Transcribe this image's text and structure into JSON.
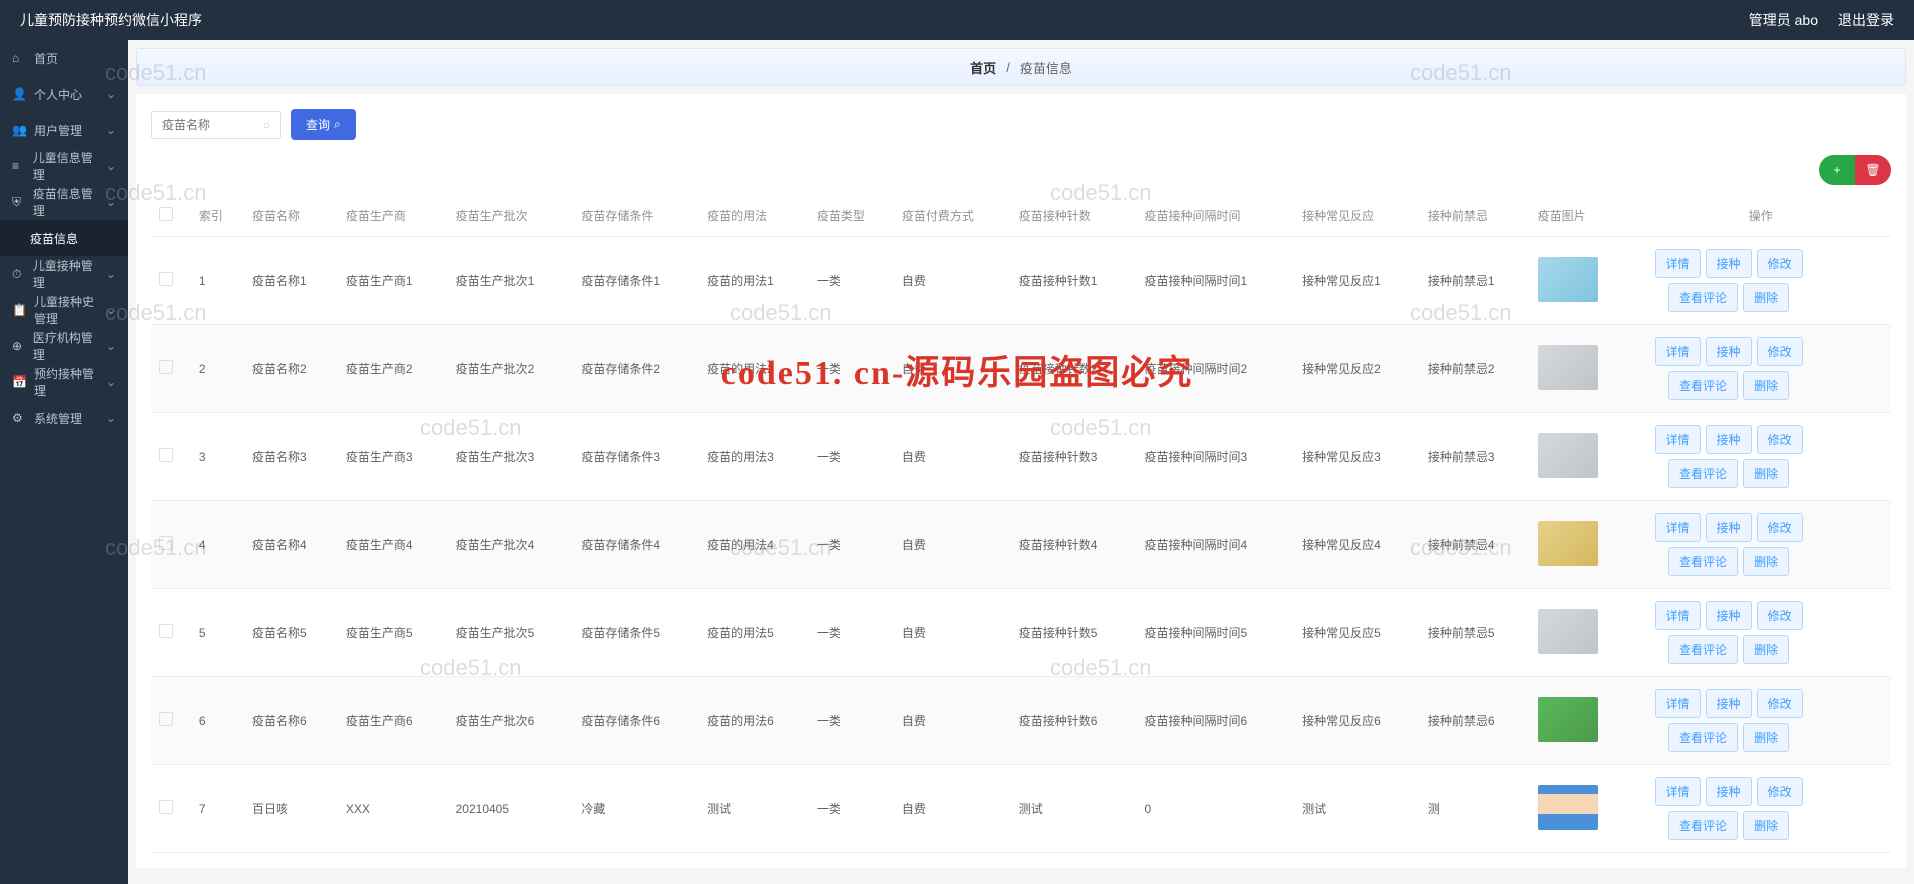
{
  "header": {
    "title": "儿童预防接种预约微信小程序",
    "admin": "管理员 abo",
    "logout": "退出登录"
  },
  "sidebar": {
    "items": [
      {
        "icon": "home",
        "label": "首页"
      },
      {
        "icon": "user",
        "label": "个人中心",
        "expand": true
      },
      {
        "icon": "users",
        "label": "用户管理",
        "expand": true
      },
      {
        "icon": "list",
        "label": "儿童信息管理",
        "expand": true
      },
      {
        "icon": "shield",
        "label": "疫苗信息管理",
        "expand": true
      },
      {
        "icon": "",
        "label": "疫苗信息",
        "sub": true
      },
      {
        "icon": "clock",
        "label": "儿童接种管理",
        "expand": true
      },
      {
        "icon": "doc",
        "label": "儿童接种史管理",
        "expand": true
      },
      {
        "icon": "hospital",
        "label": "医疗机构管理",
        "expand": true
      },
      {
        "icon": "calendar",
        "label": "预约接种管理",
        "expand": true
      },
      {
        "icon": "gear",
        "label": "系统管理",
        "expand": true
      }
    ]
  },
  "breadcrumb": {
    "home": "首页",
    "sep": "/",
    "current": "疫苗信息"
  },
  "search": {
    "placeholder": "疫苗名称",
    "button": "查询"
  },
  "table": {
    "headers": [
      "",
      "索引",
      "疫苗名称",
      "疫苗生产商",
      "疫苗生产批次",
      "疫苗存储条件",
      "疫苗的用法",
      "疫苗类型",
      "疫苗付费方式",
      "疫苗接种针数",
      "疫苗接种间隔时间",
      "接种常见反应",
      "接种前禁忌",
      "疫苗图片",
      "操作"
    ],
    "rows": [
      {
        "idx": "1",
        "name": "疫苗名称1",
        "mfr": "疫苗生产商1",
        "batch": "疫苗生产批次1",
        "storage": "疫苗存储条件1",
        "usage": "疫苗的用法1",
        "type": "一类",
        "pay": "自费",
        "doses": "疫苗接种针数1",
        "interval": "疫苗接种间隔时间1",
        "reaction": "接种常见反应1",
        "taboo": "接种前禁忌1",
        "img": "blue"
      },
      {
        "idx": "2",
        "name": "疫苗名称2",
        "mfr": "疫苗生产商2",
        "batch": "疫苗生产批次2",
        "storage": "疫苗存储条件2",
        "usage": "疫苗的用法2",
        "type": "一类",
        "pay": "自费",
        "doses": "疫苗接种针数2",
        "interval": "疫苗接种间隔时间2",
        "reaction": "接种常见反应2",
        "taboo": "接种前禁忌2",
        "img": "gray"
      },
      {
        "idx": "3",
        "name": "疫苗名称3",
        "mfr": "疫苗生产商3",
        "batch": "疫苗生产批次3",
        "storage": "疫苗存储条件3",
        "usage": "疫苗的用法3",
        "type": "一类",
        "pay": "自费",
        "doses": "疫苗接种针数3",
        "interval": "疫苗接种间隔时间3",
        "reaction": "接种常见反应3",
        "taboo": "接种前禁忌3",
        "img": "gray"
      },
      {
        "idx": "4",
        "name": "疫苗名称4",
        "mfr": "疫苗生产商4",
        "batch": "疫苗生产批次4",
        "storage": "疫苗存储条件4",
        "usage": "疫苗的用法4",
        "type": "一类",
        "pay": "自费",
        "doses": "疫苗接种针数4",
        "interval": "疫苗接种间隔时间4",
        "reaction": "接种常见反应4",
        "taboo": "接种前禁忌4",
        "img": "yellow"
      },
      {
        "idx": "5",
        "name": "疫苗名称5",
        "mfr": "疫苗生产商5",
        "batch": "疫苗生产批次5",
        "storage": "疫苗存储条件5",
        "usage": "疫苗的用法5",
        "type": "一类",
        "pay": "自费",
        "doses": "疫苗接种针数5",
        "interval": "疫苗接种间隔时间5",
        "reaction": "接种常见反应5",
        "taboo": "接种前禁忌5",
        "img": "gray"
      },
      {
        "idx": "6",
        "name": "疫苗名称6",
        "mfr": "疫苗生产商6",
        "batch": "疫苗生产批次6",
        "storage": "疫苗存储条件6",
        "usage": "疫苗的用法6",
        "type": "一类",
        "pay": "自费",
        "doses": "疫苗接种针数6",
        "interval": "疫苗接种间隔时间6",
        "reaction": "接种常见反应6",
        "taboo": "接种前禁忌6",
        "img": "green"
      },
      {
        "idx": "7",
        "name": "百日咳",
        "mfr": "XXX",
        "batch": "20210405",
        "storage": "冷藏",
        "usage": "测试",
        "type": "一类",
        "pay": "自费",
        "doses": "测试",
        "interval": "0",
        "reaction": "测试",
        "taboo": "测",
        "img": "face"
      }
    ],
    "actions": {
      "detail": "详情",
      "vaccinate": "接种",
      "edit": "修改",
      "comments": "查看评论",
      "delete": "删除"
    }
  },
  "watermarks": {
    "small": "code51.cn",
    "main": "code51. cn-源码乐园盗图必究"
  }
}
